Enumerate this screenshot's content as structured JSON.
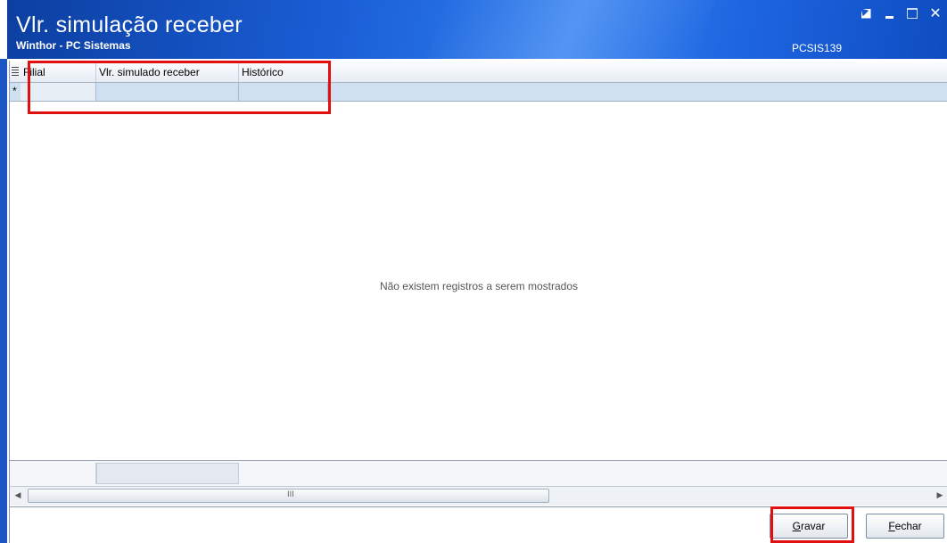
{
  "window": {
    "title": "Vlr. simulação receber",
    "subtitle": "Winthor - PC Sistemas",
    "code": "PCSIS139",
    "controls": [
      "restore-icon",
      "minimize-icon",
      "maximize-icon",
      "close-icon"
    ]
  },
  "grid": {
    "columns": [
      "Filial",
      "Vlr. simulado receber",
      "Histórico"
    ],
    "new_row_indicator": "*",
    "empty_message": "Não existem registros a serem mostrados",
    "scroll_grip": "III"
  },
  "buttons": {
    "save_label": "Gravar",
    "save_mnemonic": "G",
    "save_rest": "ravar",
    "close_label": "Fechar",
    "close_mnemonic": "F",
    "close_rest": "echar"
  },
  "colors": {
    "titlebar": "#1a5ed6",
    "highlight": "#e01010",
    "new_row": "#cfe0f0"
  }
}
